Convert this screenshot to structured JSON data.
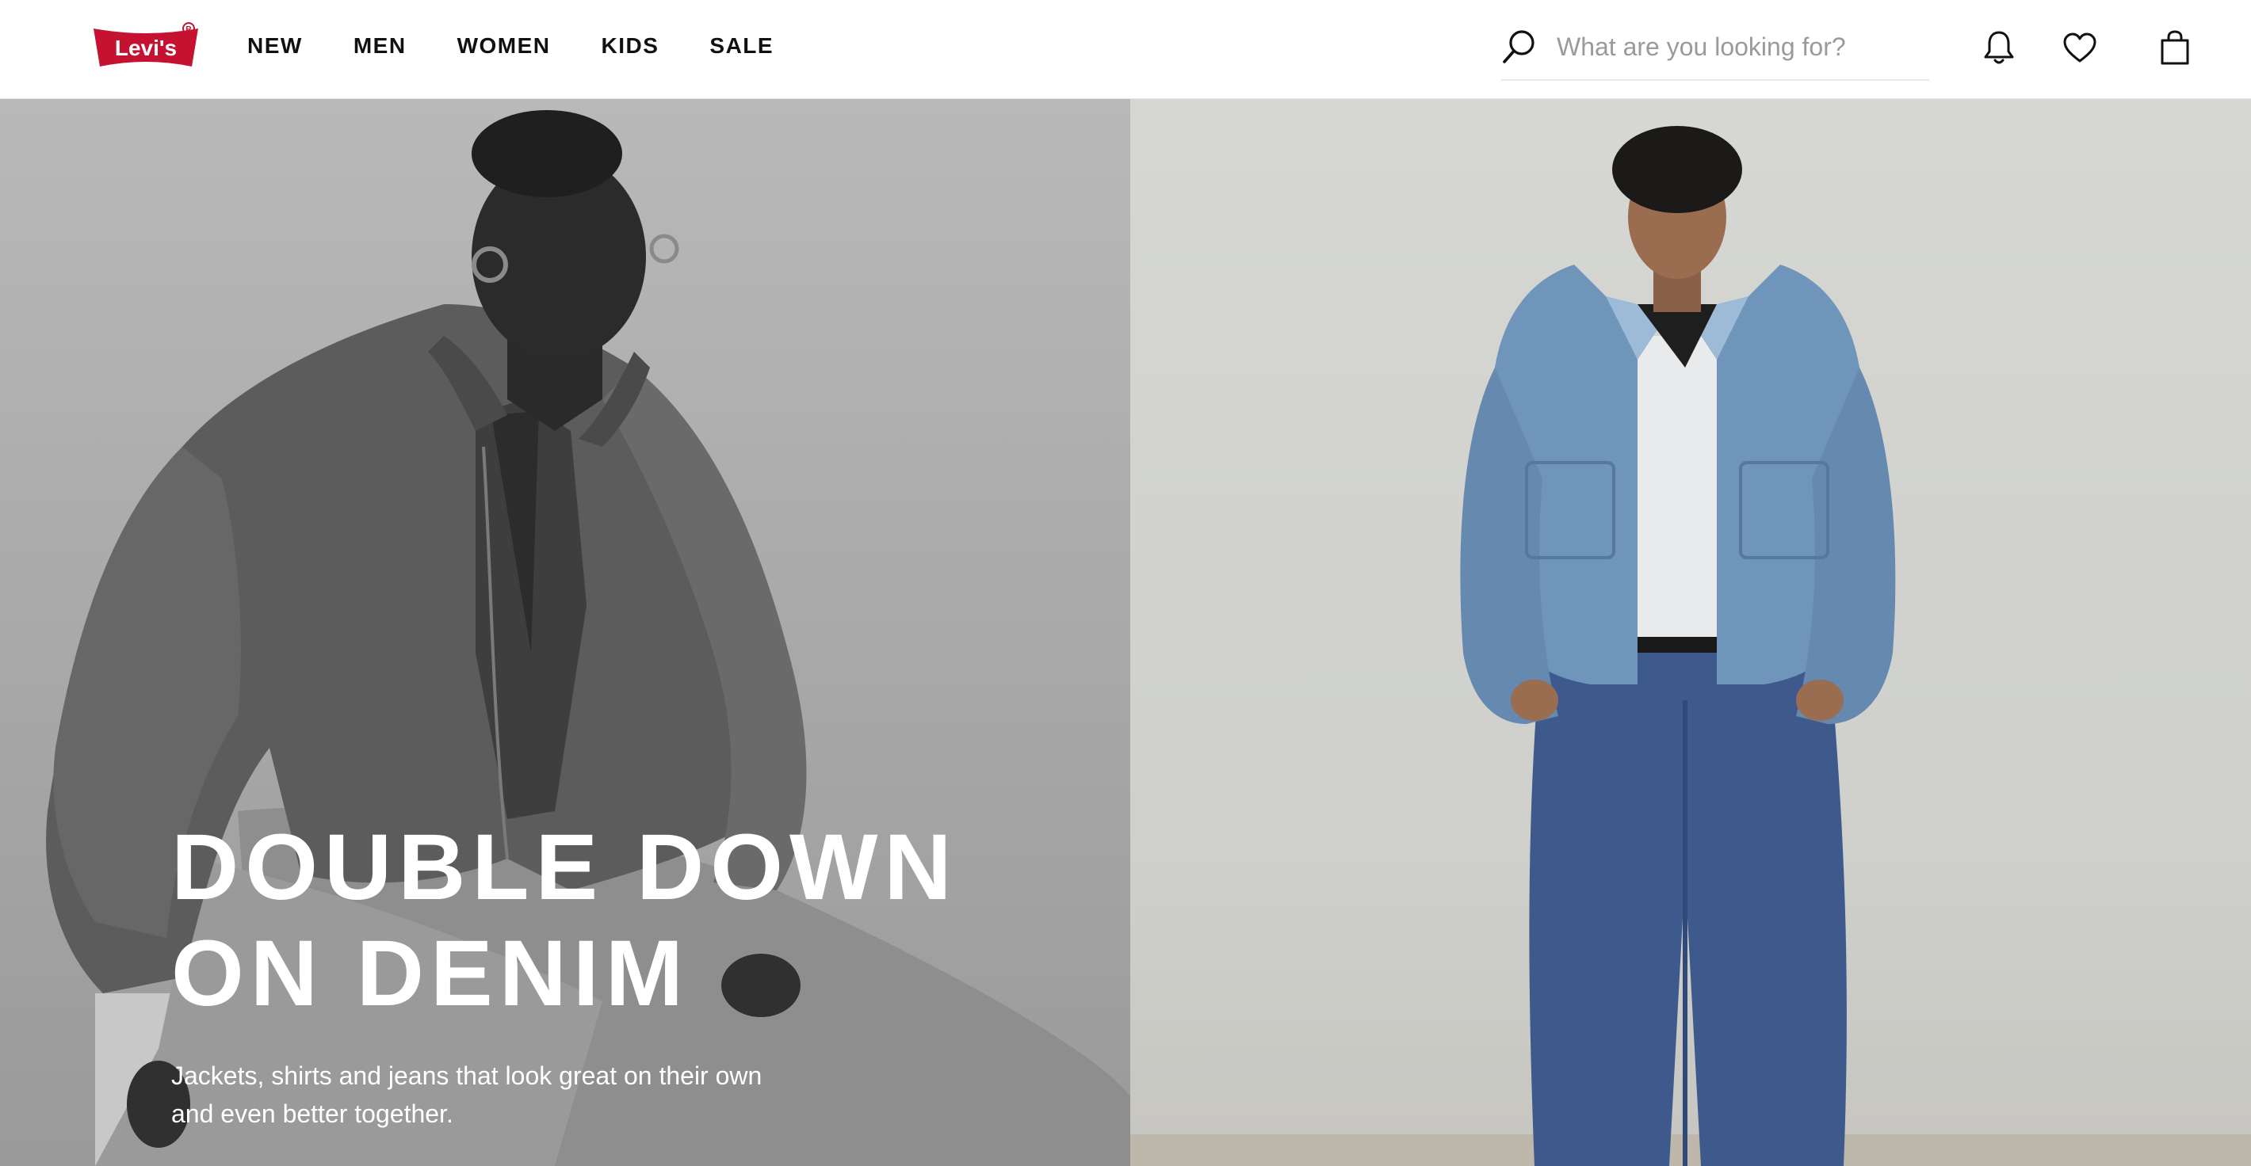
{
  "brand": {
    "logo_text": "Levi's",
    "logo_color": "#c41230"
  },
  "nav": {
    "items": [
      {
        "label": "NEW"
      },
      {
        "label": "MEN"
      },
      {
        "label": "WOMEN"
      },
      {
        "label": "KIDS"
      },
      {
        "label": "SALE"
      }
    ]
  },
  "search": {
    "placeholder": "What are you looking for?",
    "value": "",
    "icon": "search-icon"
  },
  "header_icons": {
    "notifications": "bell-icon",
    "wishlist": "heart-icon",
    "cart": "shopping-bag-icon"
  },
  "hero": {
    "headline_line1": "DOUBLE DOWN",
    "headline_line2": "ON DENIM",
    "subtext_line1": "Jackets, shirts and jeans that look great on their own",
    "subtext_line2": "and even better together.",
    "left_image": "woman in denim jacket, black and white",
    "right_image": "man in denim jacket and jeans",
    "text_color": "#ffffff"
  }
}
